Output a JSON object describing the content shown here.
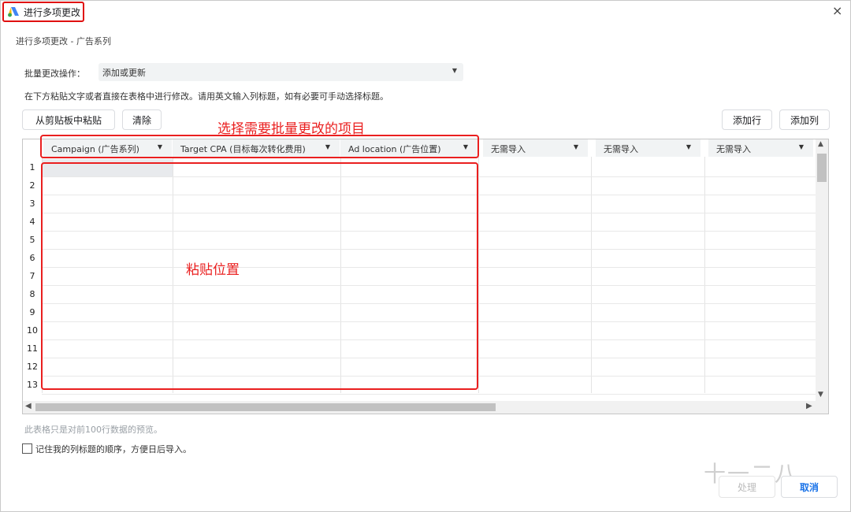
{
  "window": {
    "title": "进行多项更改",
    "close_icon": "×",
    "subtitle": "进行多项更改 - 广告系列"
  },
  "operation": {
    "label": "批量更改操作：",
    "value": "添加或更新"
  },
  "help_text": "在下方粘贴文字或者直接在表格中进行修改。请用英文输入列标题，如有必要可手动选择标题。",
  "toolbar": {
    "paste": "从剪贴板中粘贴",
    "clear": "清除",
    "add_row": "添加行",
    "add_col": "添加列"
  },
  "annotations": {
    "select_header": "选择需要批量更改的项目",
    "paste_area": "粘贴位置"
  },
  "columns": [
    "Campaign (广告系列)",
    "Target CPA (目标每次转化费用)",
    "Ad location (广告位置)",
    "无需导入",
    "无需导入",
    "无需导入"
  ],
  "rows": [
    "1",
    "2",
    "3",
    "4",
    "5",
    "6",
    "7",
    "8",
    "9",
    "10",
    "11",
    "12",
    "13"
  ],
  "preview_note": "此表格只是对前100行数据的预览。",
  "remember_label": "记住我的列标题的顺序，方便日后导入。",
  "footer": {
    "process": "处理",
    "cancel": "取消"
  },
  "watermark": "十一二八",
  "colors": {
    "accent_red": "#ea1f1f",
    "brand_blue": "#1a73e8"
  }
}
